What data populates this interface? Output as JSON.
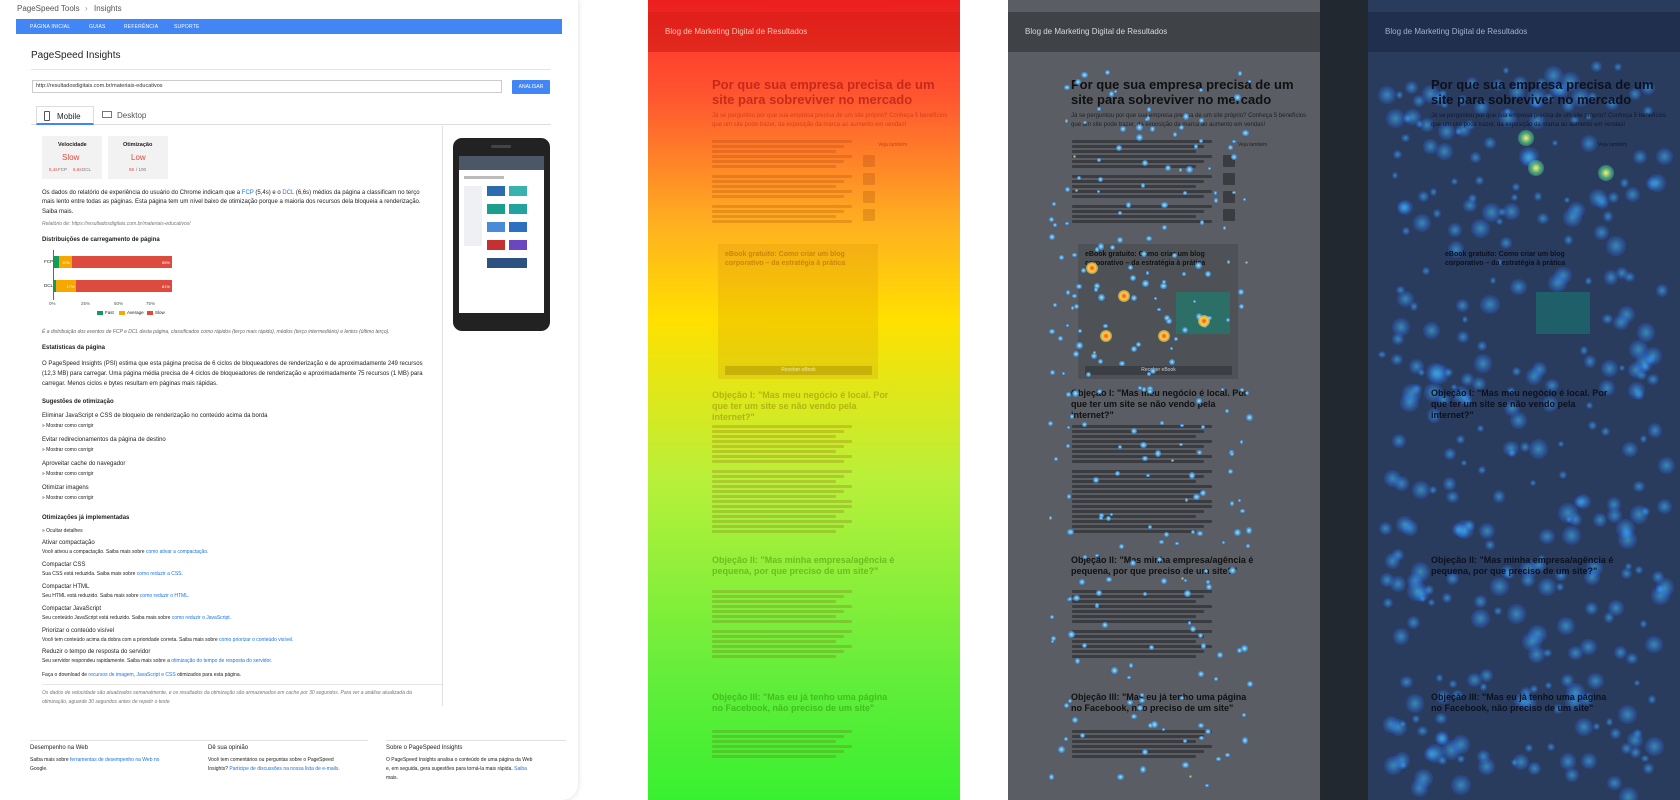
{
  "pagespeed": {
    "brand": "PageSpeed Tools",
    "brand_sep": "›",
    "brand_section": "Insights",
    "nav": [
      "PÁGINA INICIAL",
      "GUIAS",
      "REFERÊNCIA",
      "SUPORTE"
    ],
    "page_title": "PageSpeed Insights",
    "url_value": "http://resultadosdigitais.com.br/materiais-educativos",
    "analyze_label": "ANALISAR",
    "tabs": [
      {
        "label": "Mobile"
      },
      {
        "label": "Desktop"
      }
    ],
    "cards": [
      {
        "title": "Velocidade",
        "value": "Slow",
        "sub_a": "5,4s",
        "sub_a_label": "FCP",
        "sub_b": "6,6s",
        "sub_b_label": "DCL"
      },
      {
        "title": "Otimização",
        "value": "Low",
        "sub_a": "59",
        "sub_a_label": "/ 100"
      }
    ],
    "summary": {
      "p1_a": "Os dados do relatório de experiência do usuário do Chrome indicam que a ",
      "fcp_link": "FCP",
      "p1_b": " (5,4s) e o ",
      "dcl_link": "DCL",
      "p1_c": " (6,6s) médios da página a classificam no terço",
      "p1_line2": "mais lento entre todas as páginas. Esta página tem um nível baixo de otimização porque a maioria dos recursos dela bloqueia a renderização.",
      "more_link": "Saiba mais.",
      "rel": "Relatório de: https://resultadosdigitais.com.br/materiais-educativos/"
    },
    "dist": {
      "title": "Distribuições de carregamento de página",
      "rows": [
        {
          "label": "FCP",
          "fast": 4,
          "avg": 11,
          "slow": 85
        },
        {
          "label": "DCL",
          "fast": 2,
          "avg": 17,
          "slow": 81
        }
      ],
      "ticks": [
        "0%",
        "25%",
        "50%",
        "75%"
      ],
      "legend": [
        "Fast",
        "Average",
        "Slow"
      ],
      "colors": {
        "fast": "#109d58",
        "avg": "#f7a800",
        "slow": "#dd4b3e"
      },
      "caption": "É a distribuição dos eventos de FCP e DCL desta página, classificados como rápidos (terço mais rápido), médios (terço intermediário) e lentos (último terço)."
    },
    "stats": {
      "title": "Estatísticas da página",
      "lines": [
        "O PageSpeed Insights (PSI) estima que esta página precisa de 6 ciclos de bloqueadores de renderização e de aproximadamente 249 recursos",
        "(12,3 MB) para carregar. Uma página média precisa de 4 ciclos de bloqueadores de renderização e aproximadamente 75 recursos (1 MB) para",
        "carregar. Menos ciclos e bytes resultam em páginas mais rápidas."
      ]
    },
    "suggestions": {
      "title": "Sugestões de otimização",
      "items": [
        {
          "label": "Eliminar JavaScript e CSS de bloqueio de renderização no conteúdo acima da borda",
          "link": "» Mostrar como corrigir"
        },
        {
          "label": "Evitar redirecionamentos da página de destino",
          "link": "» Mostrar como corrigir"
        },
        {
          "label": "Aproveitar cache do navegador",
          "link": "» Mostrar como corrigir"
        },
        {
          "label": "Otimizar imagens",
          "link": "» Mostrar como corrigir"
        }
      ]
    },
    "implemented": {
      "title": "Otimizações já implementadas",
      "hide_link": "» Ocultar detalhes",
      "items": [
        {
          "title": "Ativar compactação",
          "text": "Você ativou a compactação. Saiba mais sobre ",
          "link": "como ativar a compactação."
        },
        {
          "title": "Compactar CSS",
          "text": "Sua CSS está reduzida. Saiba mais sobre ",
          "link": "como reduzir a CSS."
        },
        {
          "title": "Compactar HTML",
          "text": "Seu HTML está reduzido. Saiba mais sobre ",
          "link": "como reduzir o HTML."
        },
        {
          "title": "Compactar JavaScript",
          "text": "Seu conteúdo JavaScript está reduzido. Saiba mais sobre ",
          "link": "como reduzir o JavaScript."
        },
        {
          "title": "Priorizar o conteúdo visível",
          "text": "Você tem conteúdo acima da dobra com a prioridade correta. Saiba mais sobre ",
          "link": "como priorizar o conteúdo visível."
        },
        {
          "title": "Reduzir o tempo de resposta do servidor",
          "text": "Seu servidor respondeu rapidamente. Saiba mais sobre a ",
          "link": "otimização do tempo de resposta do servidor."
        }
      ],
      "download_a": "Faça o download de ",
      "download_link": "recursos de imagem, JavaScript e CSS",
      "download_b": " otimizados para esta página."
    },
    "footnote_1": "Os dados de velocidade são atualizados semanalmente, e os resultados da otimização são armazenados em cache por 30 segundos. Para ver a análise atualizada da",
    "footnote_2": "otimização, aguarde 30 segundos antes de repetir o teste.",
    "footer": [
      {
        "title": "Desempenho na Web",
        "l1a": "Saiba mais sobre ",
        "l1link": "ferramentas de desempenho na Web no",
        "l2link": "Google."
      },
      {
        "title": "Dê sua opinião",
        "l1a": "Você tem comentários ou perguntas sobre o PageSpeed",
        "l2a": "Insights? ",
        "l2link": "Participe de discussões na nossa lista de e-mails."
      },
      {
        "title": "Sobre o PageSpeed Insights",
        "l1a": "O PageSpeed Insights analisa o conteúdo de uma página da Web",
        "l2a": "e, em seguida, gera sugestões para torná-la mais rápida. ",
        "l2link": "Saiba",
        "l3link": "mais."
      }
    ]
  },
  "heatmap_views": {
    "blog_title": "Blog de Marketing Digital de Resultados",
    "article_title_1": "Por que sua empresa precisa de um",
    "article_title_2": "site para sobreviver no mercado",
    "lead_1": "Já se perguntou por que sua empresa precisa de um site próprio? Conheça 5 benefícios",
    "lead_2": "que um site pode trazer, da exposição da marca ao aumento em vendas!",
    "ebook_1": "eBook gratuito: Como criar um blog",
    "ebook_2": "corporativo – da estratégia à prática",
    "ebook_button": "Receber eBook",
    "obj1_1": "Objeção I: \"Mas meu negócio é local. Por",
    "obj1_2": "que ter um site se não vendo pela",
    "obj1_3": "internet?\"",
    "obj2_1": "Objeção II: \"Mas minha empresa/agência é",
    "obj2_2": "pequena, por que preciso de um site?\"",
    "obj3_1": "Objeção III: \"Mas eu já tenho uma página",
    "obj3_2": "no Facebook, não preciso de um site\"",
    "sidebar_title": "Veja também",
    "scroll_map_colors": {
      "top": "#ff2a2a",
      "mid": "#ffe000",
      "bottom": "#31f030"
    }
  }
}
